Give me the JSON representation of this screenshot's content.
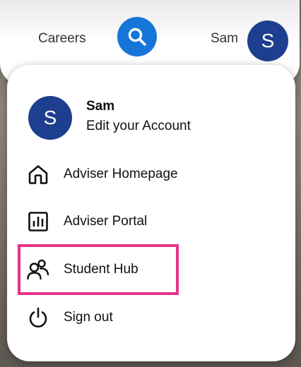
{
  "header": {
    "nav_link": "Careers",
    "user_name": "Sam",
    "avatar_initial": "S",
    "search_icon": "search-icon"
  },
  "menu": {
    "profile": {
      "avatar_initial": "S",
      "name": "Sam",
      "subtitle": "Edit your Account"
    },
    "items": [
      {
        "label": "Adviser Homepage",
        "icon": "home-icon"
      },
      {
        "label": "Adviser Portal",
        "icon": "bar-chart-icon"
      },
      {
        "label": "Student Hub",
        "icon": "users-icon"
      },
      {
        "label": "Sign out",
        "icon": "power-icon"
      }
    ]
  },
  "colors": {
    "brand_blue": "#1676d8",
    "avatar_navy": "#1e3f8f",
    "highlight": "#e8338a"
  }
}
